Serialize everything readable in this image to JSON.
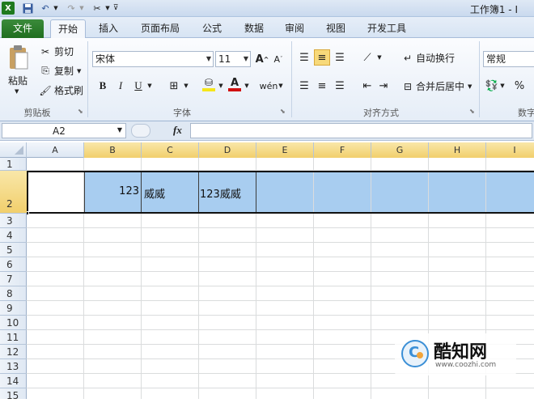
{
  "titlebar": {
    "title": "工作簿1 - I"
  },
  "tabs": [
    {
      "label": "文件"
    },
    {
      "label": "开始"
    },
    {
      "label": "插入"
    },
    {
      "label": "页面布局"
    },
    {
      "label": "公式"
    },
    {
      "label": "数据"
    },
    {
      "label": "审阅"
    },
    {
      "label": "视图"
    },
    {
      "label": "开发工具"
    }
  ],
  "clipboard": {
    "paste": "粘贴",
    "cut": "剪切",
    "copy": "复制",
    "format_painter": "格式刷",
    "label": "剪贴板"
  },
  "font": {
    "name": "宋体",
    "size": "11",
    "bold": "B",
    "italic": "I",
    "underline": "U",
    "label": "字体"
  },
  "alignment": {
    "wrap": "自动换行",
    "merge": "合并后居中",
    "label": "对齐方式"
  },
  "number": {
    "format": "常规",
    "percent": "%",
    "label": "数字"
  },
  "formula_bar": {
    "name_box": "A2",
    "fx": "fx",
    "formula": ""
  },
  "columns": [
    "A",
    "B",
    "C",
    "D",
    "E",
    "F",
    "G",
    "H",
    "I"
  ],
  "rows": [
    "1",
    "2",
    "3",
    "4",
    "5",
    "6",
    "7",
    "8",
    "9",
    "10",
    "11",
    "12",
    "13",
    "14",
    "15"
  ],
  "cells": {
    "B2": "123",
    "C2": "威威",
    "D2": "123威威"
  },
  "watermark": {
    "brand": "酷知网",
    "url": "www.coozhi.com"
  }
}
